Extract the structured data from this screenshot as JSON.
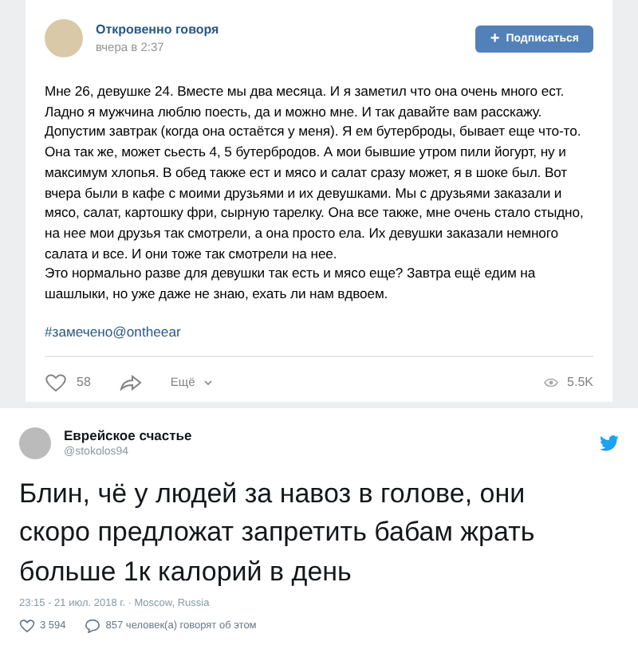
{
  "post": {
    "author": "Откровенно говоря",
    "time": "вчера в 2:37",
    "subscribe": {
      "icon": "+",
      "label": "Подписаться"
    },
    "paragraphs": [
      "Мне 26, девушке 24. Вместе мы два месяца. И я заметил что она очень много ест.\nЛадно я мужчина люблю поесть, да и можно мне. И так давайте вам расскажу.\nДопустим завтрак (когда она остаётся у меня). Я ем бутерброды, бывает еще что-то.\nОна так же, может сьесть 4, 5 бутербродов. А мои бывшие утром пили йогурт, ну и\nмаксимум хлопья. В обед также ест и мясо и салат сразу может, я в шоке был. Вот\nвчера были в кафе с моими друзьями и их девушками. Мы с друзьями заказали и\nмясо, салат, картошку фри, сырную тарелку. Она все также, мне очень стало стыдно,\nна нее мои друзья так смотрели, а она просто ела. Их девушки заказали немного\nсалата и все. И они тоже так смотрели на нее.",
      "Это нормально разве для девушки так есть и мясо еще? Завтра ещё едим на\nшашлыки, но уже даже не знаю, ехать ли нам вдвоем."
    ],
    "hashtag": "#замечено@ontheear",
    "likes": "58",
    "more": "Ещё",
    "views": "5.5K"
  },
  "tweet": {
    "name": "Еврейское счастье",
    "handle": "@stokolos94",
    "text": "Блин, чё у людей за навоз в голове, они\nскоро предложат запретить бабам жрать\nбольше 1к калорий в день",
    "meta": "23:15 - 21 июл. 2018 г. · Moscow, Russia",
    "likes": "3 594",
    "replies": "857 человек(а) говорят об этом"
  }
}
